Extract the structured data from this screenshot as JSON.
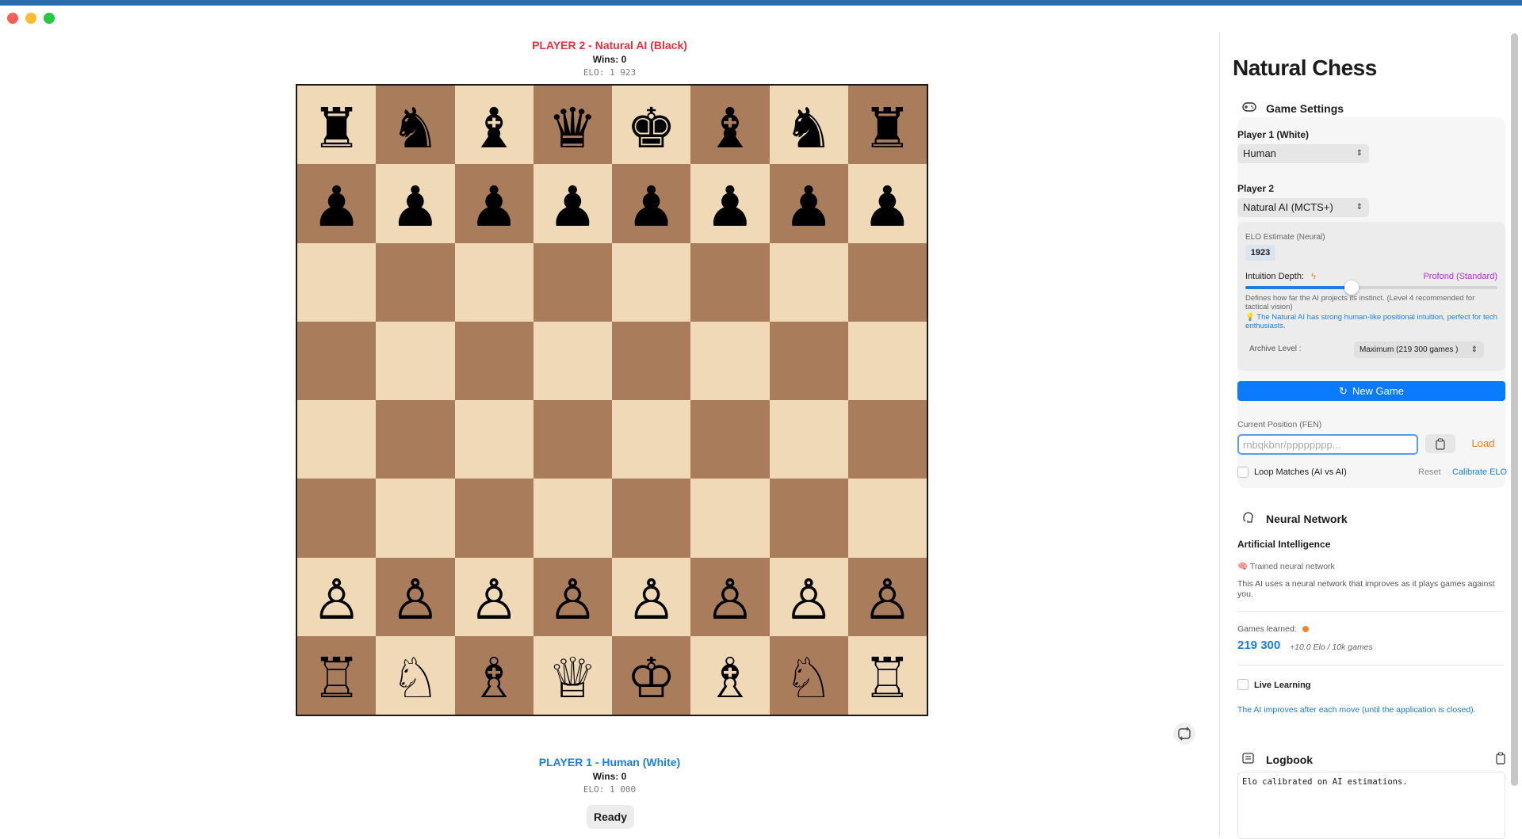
{
  "window": {
    "title": "Natural Chess"
  },
  "players": {
    "top": {
      "name": "PLAYER 2 - Natural AI (Black)",
      "wins": "Wins: 0",
      "elo": "ELO: 1 923"
    },
    "bottom": {
      "name": "PLAYER 1 - Human (White)",
      "wins": "Wins: 0",
      "elo": "ELO: 1 000"
    }
  },
  "status": "Ready",
  "board": {
    "ranks": [
      [
        "♜",
        "♞",
        "♝",
        "♛",
        "♚",
        "♝",
        "♞",
        "♜"
      ],
      [
        "♟",
        "♟",
        "♟",
        "♟",
        "♟",
        "♟",
        "♟",
        "♟"
      ],
      [
        "",
        "",
        "",
        "",
        "",
        "",
        "",
        ""
      ],
      [
        "",
        "",
        "",
        "",
        "",
        "",
        "",
        ""
      ],
      [
        "",
        "",
        "",
        "",
        "",
        "",
        "",
        ""
      ],
      [
        "",
        "",
        "",
        "",
        "",
        "",
        "",
        ""
      ],
      [
        "♙",
        "♙",
        "♙",
        "♙",
        "♙",
        "♙",
        "♙",
        "♙"
      ],
      [
        "♖",
        "♘",
        "♗",
        "♕",
        "♔",
        "♗",
        "♘",
        "♖"
      ]
    ],
    "colors": {
      "light": "#efd9b6",
      "dark": "#a97d5b"
    }
  },
  "sidebar": {
    "title": "Natural Chess",
    "game_settings": {
      "heading": "Game Settings",
      "player1_label": "Player 1 (White)",
      "player1_value": "Human",
      "player2_label": "Player 2",
      "player2_value": "Natural AI (MCTS+)",
      "elo_label": "ELO Estimate (Neural)",
      "elo_value": "1923",
      "depth_label": "Intuition Depth:",
      "depth_value_label": "Profond (Standard)",
      "depth_level": 0.42,
      "depth_help": "Defines how far the AI projects its instinct. (Level 4 recommended for tactical vision)",
      "tip": "💡 The Natural AI has strong human-like positional intuition, perfect for tech enthusiasts.",
      "archive_label": "Archive Level :",
      "archive_value": "Maximum (219 300 games )",
      "new_game": "New Game",
      "fen_label": "Current Position (FEN)",
      "fen_placeholder": "rnbqkbnr/pppppppp...",
      "load": "Load",
      "loop_label": "Loop Matches (AI vs AI)",
      "reset": "Reset",
      "calibrate": "Calibrate ELO"
    },
    "neural": {
      "heading": "Neural Network",
      "ai_title": "Artificial Intelligence",
      "trained": "🧠 Trained neural network",
      "description": "This AI uses a neural network that improves as it plays games against you.",
      "games_label": "Games learned:",
      "games_value": "219 300",
      "rate": "+10.0 Elo / 10k games",
      "live_label": "Live Learning",
      "live_note": "The AI improves after each move (until the application is closed)."
    },
    "logbook": {
      "heading": "Logbook",
      "entry": "Elo calibrated on AI estimations."
    }
  },
  "colors": {
    "accent": "#0a7bff",
    "danger": "#e8313b",
    "link": "#1a7fe0",
    "orange": "#f07b1e",
    "purple": "#b62fd6"
  }
}
